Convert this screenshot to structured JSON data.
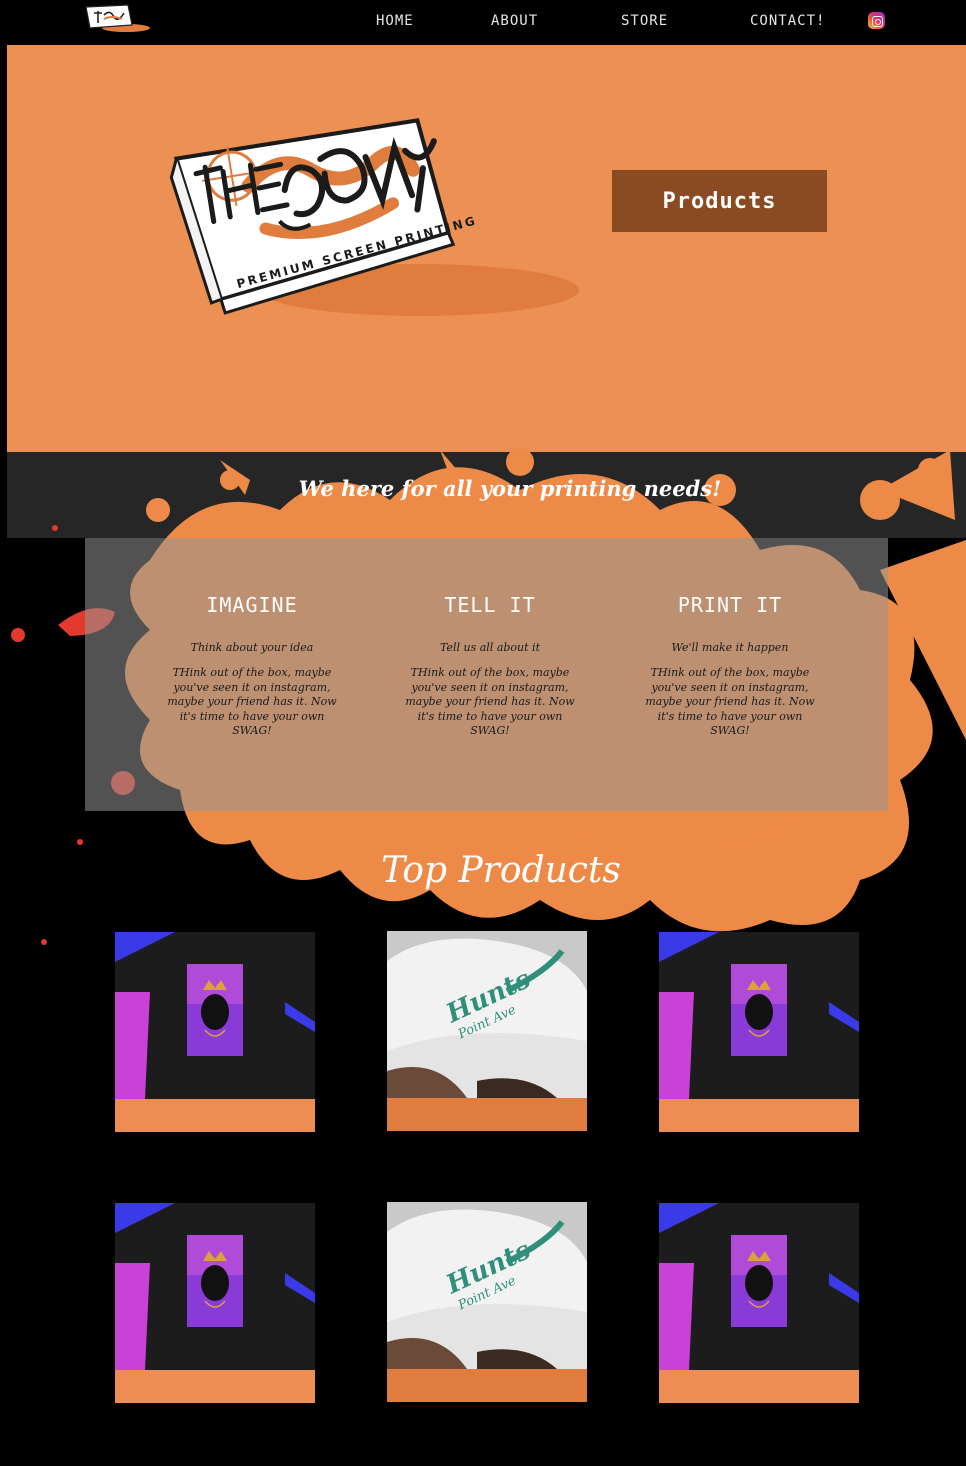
{
  "nav": {
    "home": "HOME",
    "about": "ABOUT",
    "store": "STORE",
    "contact": "CONTACT!",
    "social_icon": "instagram-icon"
  },
  "hero": {
    "logo_word": "Ebony",
    "logo_prefix": "THE",
    "logo_tagline": "PREMIUM SCREEN PRINTING",
    "button_label": "Products"
  },
  "band": {
    "tagline": "We here for all your printing needs!"
  },
  "steps": [
    {
      "title": "IMAGINE",
      "subtitle": "Think about your idea",
      "body": "THink out of the box, maybe you've seen it on instagram, maybe your friend has it. Now it's time to have your own SWAG!"
    },
    {
      "title": "TELL IT",
      "subtitle": "Tell us all about it",
      "body": "THink out of the box, maybe you've seen it on instagram, maybe your friend has it. Now it's time to have your own SWAG!"
    },
    {
      "title": "PRINT IT",
      "subtitle": "We'll make it happen",
      "body": "THink out of the box, maybe you've seen it on instagram, maybe your friend has it. Now it's time to have your own SWAG!"
    }
  ],
  "top_products": {
    "title": "Top Products",
    "items": [
      {
        "type": "tshirt"
      },
      {
        "type": "cap",
        "print_line1": "Hunts",
        "print_line2": "Point Ave"
      },
      {
        "type": "tshirt"
      },
      {
        "type": "tshirt"
      },
      {
        "type": "cap",
        "print_line1": "Hunts",
        "print_line2": "Point Ave"
      },
      {
        "type": "tshirt"
      }
    ]
  },
  "colors": {
    "hero_orange": "#ec9153",
    "button_brown": "#8a4a22",
    "splash_orange": "#ee8a47",
    "band_dark": "#262626",
    "card_bar": "#ed8d52"
  }
}
